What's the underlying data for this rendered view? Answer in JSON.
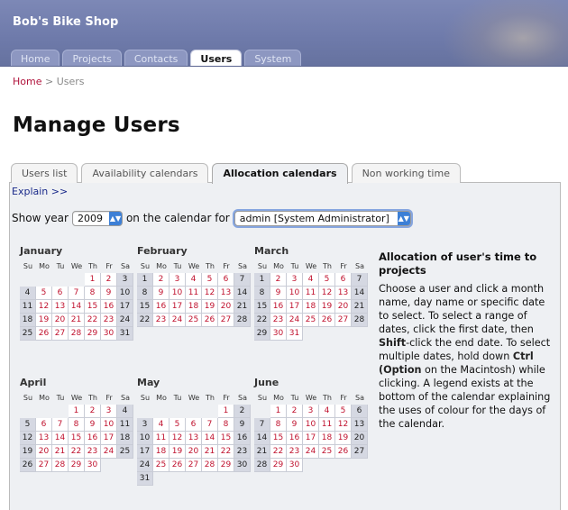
{
  "header": {
    "site_title": "Bob's Bike Shop",
    "nav_tabs": [
      {
        "label": "Home",
        "active": false
      },
      {
        "label": "Projects",
        "active": false
      },
      {
        "label": "Contacts",
        "active": false
      },
      {
        "label": "Users",
        "active": true
      },
      {
        "label": "System",
        "active": false
      }
    ]
  },
  "breadcrumb": {
    "home": "Home",
    "separator": ">",
    "current": "Users"
  },
  "page_title": "Manage Users",
  "sub_tabs": [
    {
      "label": "Users list",
      "active": false
    },
    {
      "label": "Availability calendars",
      "active": false
    },
    {
      "label": "Allocation calendars",
      "active": true
    },
    {
      "label": "Non working time",
      "active": false
    }
  ],
  "explain_link": "Explain >>",
  "controls": {
    "show_year_label": "Show year",
    "year_value": "2009",
    "calendar_for_label": "on the calendar for",
    "user_value": "admin [System Administrator]"
  },
  "weekday_headers": [
    "Su",
    "Mo",
    "Tu",
    "We",
    "Th",
    "Fr",
    "Sa"
  ],
  "calendars": [
    {
      "name": "January",
      "first_weekday": 4,
      "days": 31
    },
    {
      "name": "February",
      "first_weekday": 0,
      "days": 28
    },
    {
      "name": "March",
      "first_weekday": 0,
      "days": 31
    },
    {
      "name": "April",
      "first_weekday": 3,
      "days": 30
    },
    {
      "name": "May",
      "first_weekday": 5,
      "days": 31
    },
    {
      "name": "June",
      "first_weekday": 1,
      "days": 30
    }
  ],
  "info": {
    "title": "Allocation of user's time to projects",
    "text_1": "Choose a user and click a month name, day name or specific date to select. To select a range of dates, click the first date, then ",
    "shift": "Shift",
    "text_2": "-click the end date. To select multiple dates, hold down ",
    "ctrl": "Ctrl (Option",
    "text_3": " on the Macintosh) while clicking. A legend exists at the bottom of the calendar explaining the uses of colour for the days of the calendar."
  },
  "colors": {
    "header_bg": "#6f7bab",
    "link_red": "#b0123b",
    "weekday_red": "#c0122e",
    "weekend_grey": "#d5d8e2",
    "explain_blue": "#1a2a8a",
    "focus_blue": "#86a6e0"
  }
}
